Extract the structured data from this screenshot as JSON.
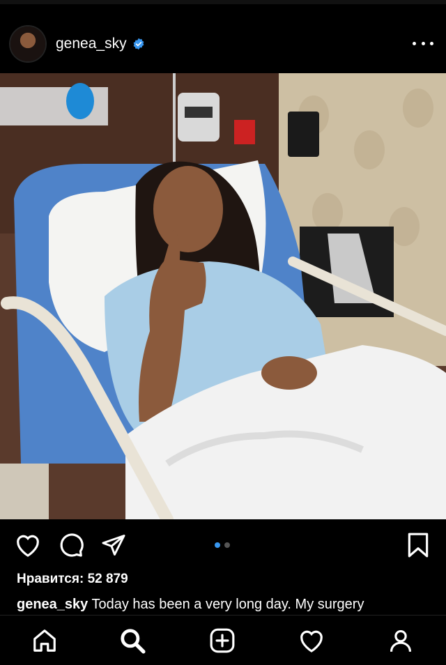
{
  "post": {
    "username": "genea_sky",
    "verified": true,
    "likes_label": "Нравится: 52 879",
    "caption_username": "genea_sky",
    "caption_text": " Today has been a very long day. My surgery"
  },
  "carousel": {
    "current": 1,
    "total": 2
  },
  "icons": {
    "header": [
      "verified-badge-icon",
      "more-options-icon"
    ],
    "actions": [
      "heart-icon",
      "comment-icon",
      "share-icon",
      "bookmark-icon"
    ],
    "tabs": [
      "home-icon",
      "search-icon",
      "create-post-icon",
      "activity-heart-icon",
      "profile-icon"
    ]
  },
  "colors": {
    "background": "#000000",
    "text": "#ffffff",
    "accent": "#3897f0"
  }
}
